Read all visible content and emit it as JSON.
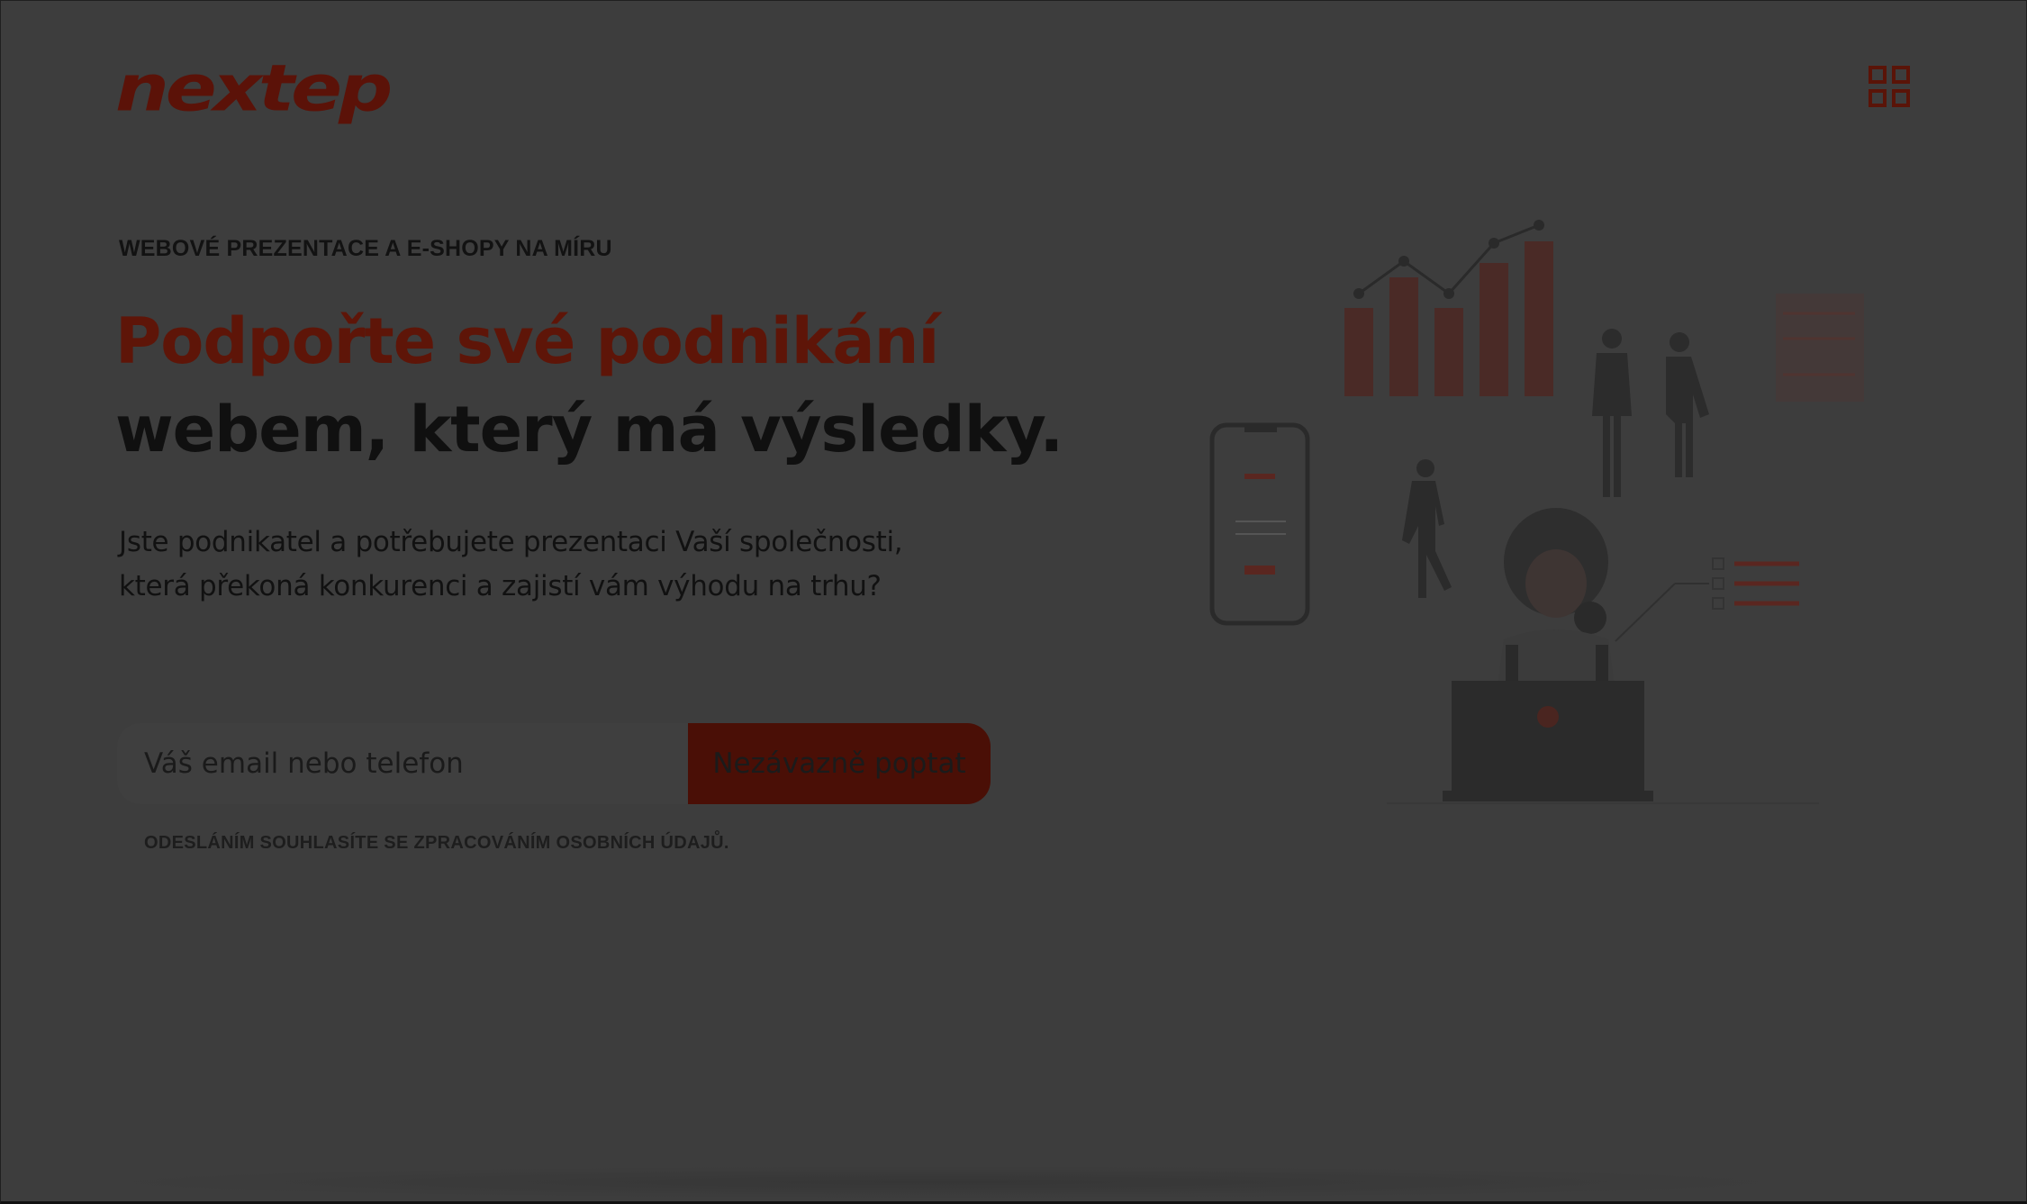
{
  "brand": {
    "logo_text": "nextep"
  },
  "header": {
    "menu_icon": "grid-icon"
  },
  "hero": {
    "eyebrow": "WEBOVÉ PREZENTACE A E-SHOPY NA MÍRU",
    "headline_line1": "Podpořte své podnikání",
    "headline_line2": "webem, který má výsledky.",
    "lead_line1": "Jste podnikatel a potřebujete prezentaci Vaší společnosti,",
    "lead_line2": "která překoná konkurenci a zajistí vám výhodu na trhu?"
  },
  "form": {
    "input_placeholder": "Váš email nebo telefon",
    "submit_label": "Nezávazně poptat",
    "consent_text": "ODESLÁNÍM SOUHLASÍTE SE ZPRACOVÁNÍM OSOBNÍCH ÚDAJŮ."
  },
  "illustration": {
    "name": "business-illustration-image"
  },
  "colors": {
    "background_overlay": "#3d3d3d",
    "accent": "#5e1508",
    "button": "#4a0f06",
    "text_dark": "#101010"
  }
}
